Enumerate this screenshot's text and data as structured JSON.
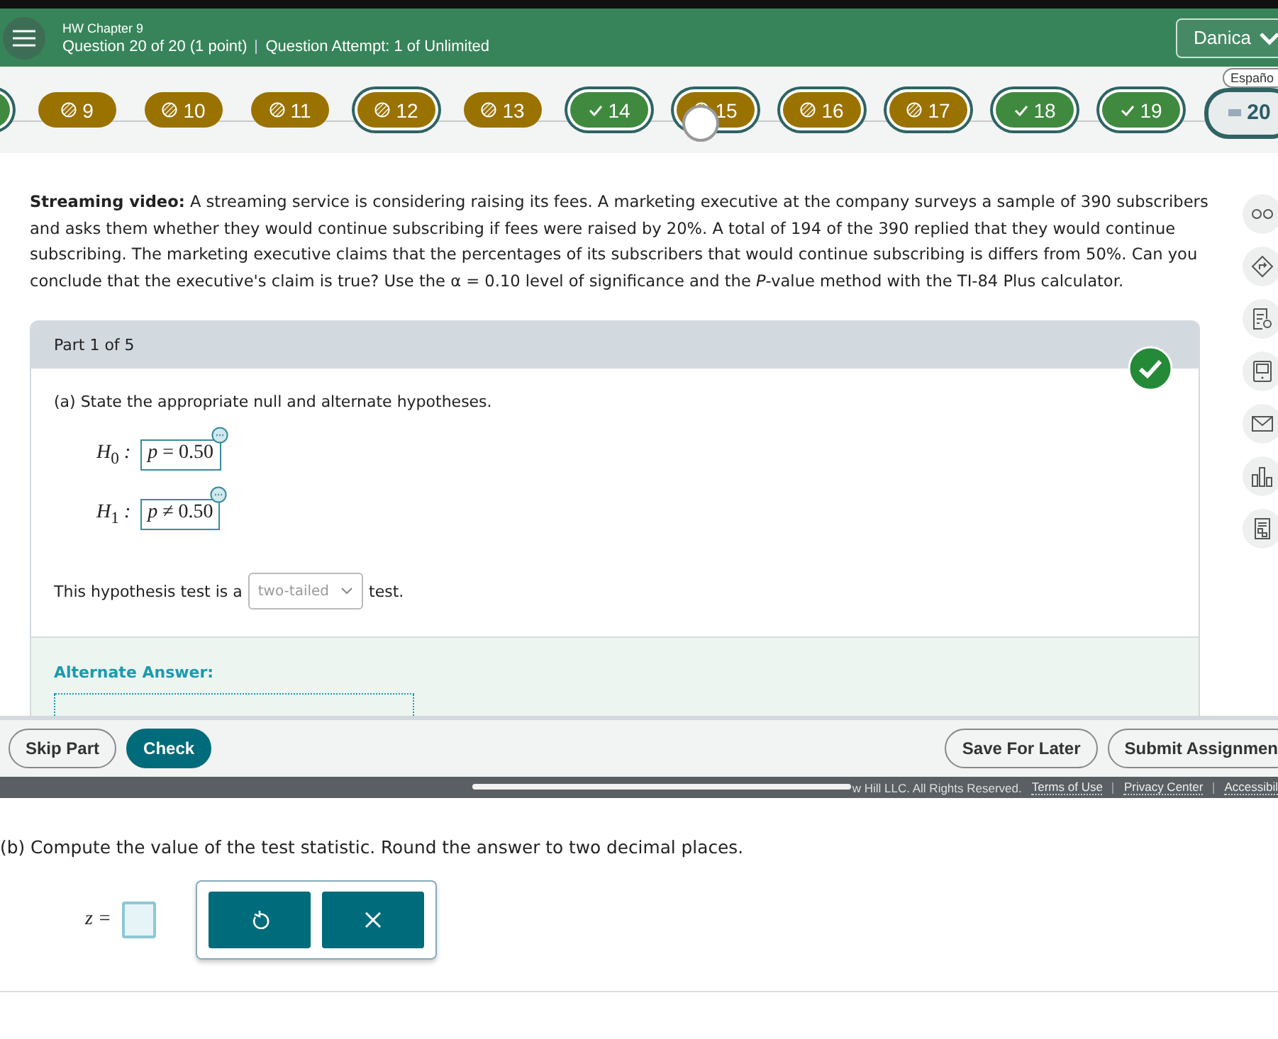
{
  "header": {
    "assignment": "HW Chapter 9",
    "question_info": "Question 20 of 20 (1 point)",
    "attempt_info": "Question Attempt: 1 of Unlimited",
    "user": "Danica"
  },
  "question_nav": [
    {
      "kind": "correct",
      "outlined": true,
      "touched": false
    },
    {
      "label": "9",
      "kind": "partial",
      "outlined": false,
      "touched": false
    },
    {
      "label": "10",
      "kind": "partial",
      "outlined": false,
      "touched": false
    },
    {
      "label": "11",
      "kind": "partial",
      "outlined": false,
      "touched": false
    },
    {
      "label": "12",
      "kind": "partial",
      "outlined": true,
      "touched": false
    },
    {
      "label": "13",
      "kind": "partial",
      "outlined": false,
      "touched": false
    },
    {
      "label": "14",
      "kind": "correct",
      "outlined": true,
      "touched": false
    },
    {
      "label": "15",
      "kind": "partial",
      "outlined": true,
      "touched": true
    },
    {
      "label": "16",
      "kind": "partial",
      "outlined": true,
      "touched": false
    },
    {
      "label": "17",
      "kind": "partial",
      "outlined": true,
      "touched": false
    },
    {
      "label": "18",
      "kind": "correct",
      "outlined": true,
      "touched": false
    },
    {
      "label": "19",
      "kind": "correct",
      "outlined": true,
      "touched": false
    },
    {
      "label": "20",
      "kind": "current",
      "outlined": true,
      "touched": false
    }
  ],
  "language_tab": "Españo",
  "question": "**Streaming video:** A streaming service is considering raising its fees. A marketing executive at the company surveys a sample of 390 subscribers and asks them whether they would continue subscribing if fees were raised by 20%. A total of 194 of the 390 replied that they would continue subscribing. The marketing executive claims that the percentages of its subscribers that would continue subscribing is differs from 50%. Can you conclude that the executive's claim is true? Use the α = 0.10 level of significance and the *P*-value method with the TI-84 Plus calculator.",
  "tools": [
    {
      "kind": "glasses"
    },
    {
      "kind": "diamond"
    },
    {
      "kind": "document-search"
    },
    {
      "kind": "calculator"
    },
    {
      "kind": "mail"
    },
    {
      "kind": "chart"
    },
    {
      "kind": "sheet"
    }
  ],
  "part": {
    "title": "Part 1 of 5",
    "correct": true,
    "prompt": "(a) State the appropriate null and alternate hypotheses.",
    "hypotheses": [
      {
        "label": "*H*$_{0}$ :",
        "value": "*p* = 0.50"
      },
      {
        "label": "*H*$_{1}$ :",
        "value": "*p* ≠ 0.50"
      }
    ],
    "test_sentence_before": "This hypothesis test is a",
    "test_type": "two-tailed",
    "test_sentence_after": "test.",
    "alternate_heading": "Alternate Answer:"
  },
  "actions": {
    "skip": "Skip Part",
    "check": "Check",
    "save": "Save For Later",
    "submit": "Submit Assignmen"
  },
  "footer": {
    "copyright": "w Hill LLC. All Rights Reserved.",
    "links": [
      "Terms of Use",
      "Privacy Center",
      "Accessibil"
    ]
  },
  "part_b": {
    "prompt": "(b) Compute the value of the test statistic. Round the answer to two decimal places.",
    "variable": "*z* =",
    "keys": [
      {
        "kind": "undo"
      },
      {
        "kind": "clear"
      }
    ]
  }
}
